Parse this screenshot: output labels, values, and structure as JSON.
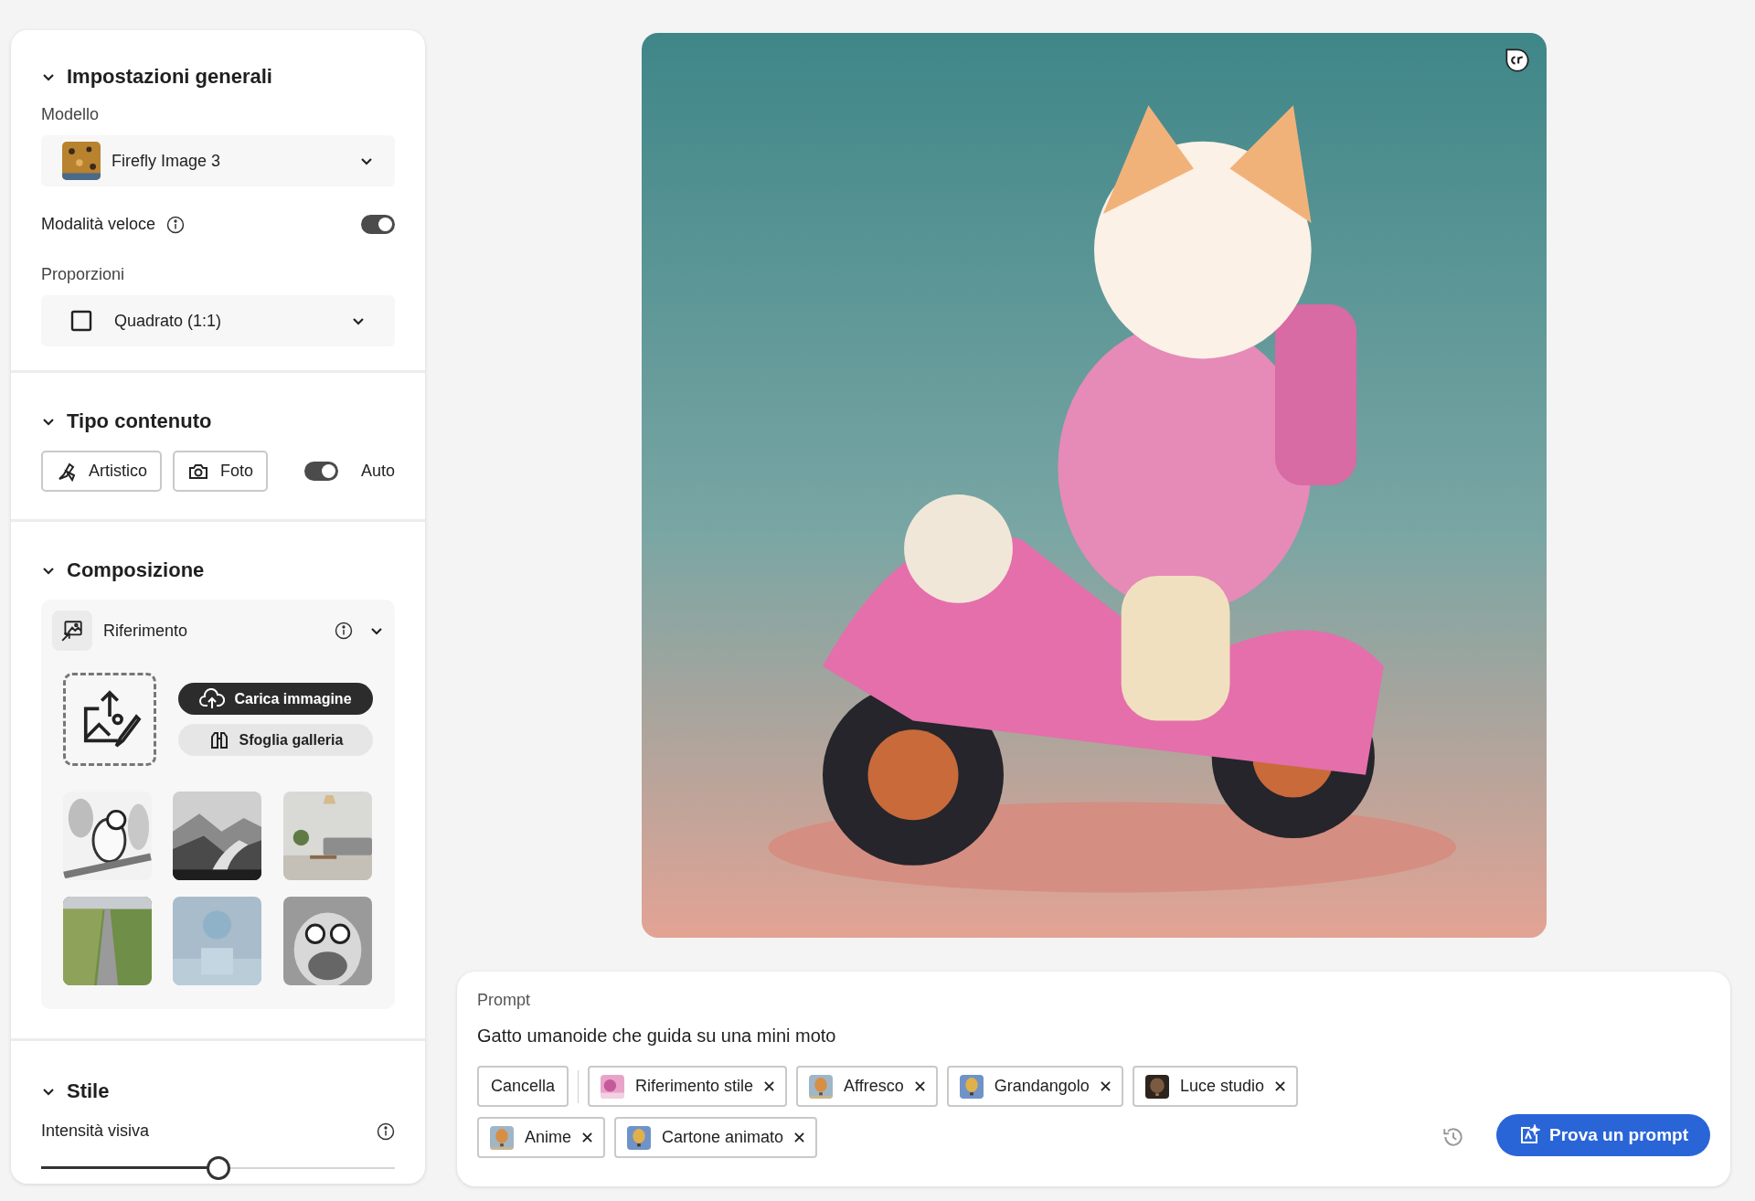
{
  "general": {
    "title": "Impostazioni generali",
    "expanded": true,
    "model_label": "Modello",
    "model": "Firefly Image 3",
    "fast_mode": {
      "label": "Modalità veloce",
      "on": true
    },
    "ratio_label": "Proporzioni",
    "ratio": "Quadrato (1:1)"
  },
  "content_type": {
    "title": "Tipo contenuto",
    "expanded": true,
    "options": [
      {
        "kind": "artistic",
        "label": "Artistico"
      },
      {
        "label": "Foto"
      }
    ],
    "auto": {
      "label": "Auto",
      "on": true
    }
  },
  "composition": {
    "title": "Composizione",
    "expanded": true,
    "reference": {
      "label": "Riferimento",
      "upload": "Carica immagine",
      "gallery": "Sfoglia galleria"
    }
  },
  "style": {
    "title": "Stile",
    "expanded": true,
    "intensity": {
      "label": "Intensità visiva",
      "level": 0.5
    }
  },
  "prompt": {
    "label": "Prompt",
    "value": "Gatto umanoide che guida su una mini moto",
    "clear": "Cancella",
    "tags": [
      {
        "label": "Riferimento stile"
      },
      {
        "label": "Affresco"
      },
      {
        "label": "Grandangolo"
      },
      {
        "label": "Luce studio"
      },
      {
        "label": "Anime"
      },
      {
        "label": "Cartone animato"
      }
    ],
    "try_button": "Prova un prompt"
  }
}
